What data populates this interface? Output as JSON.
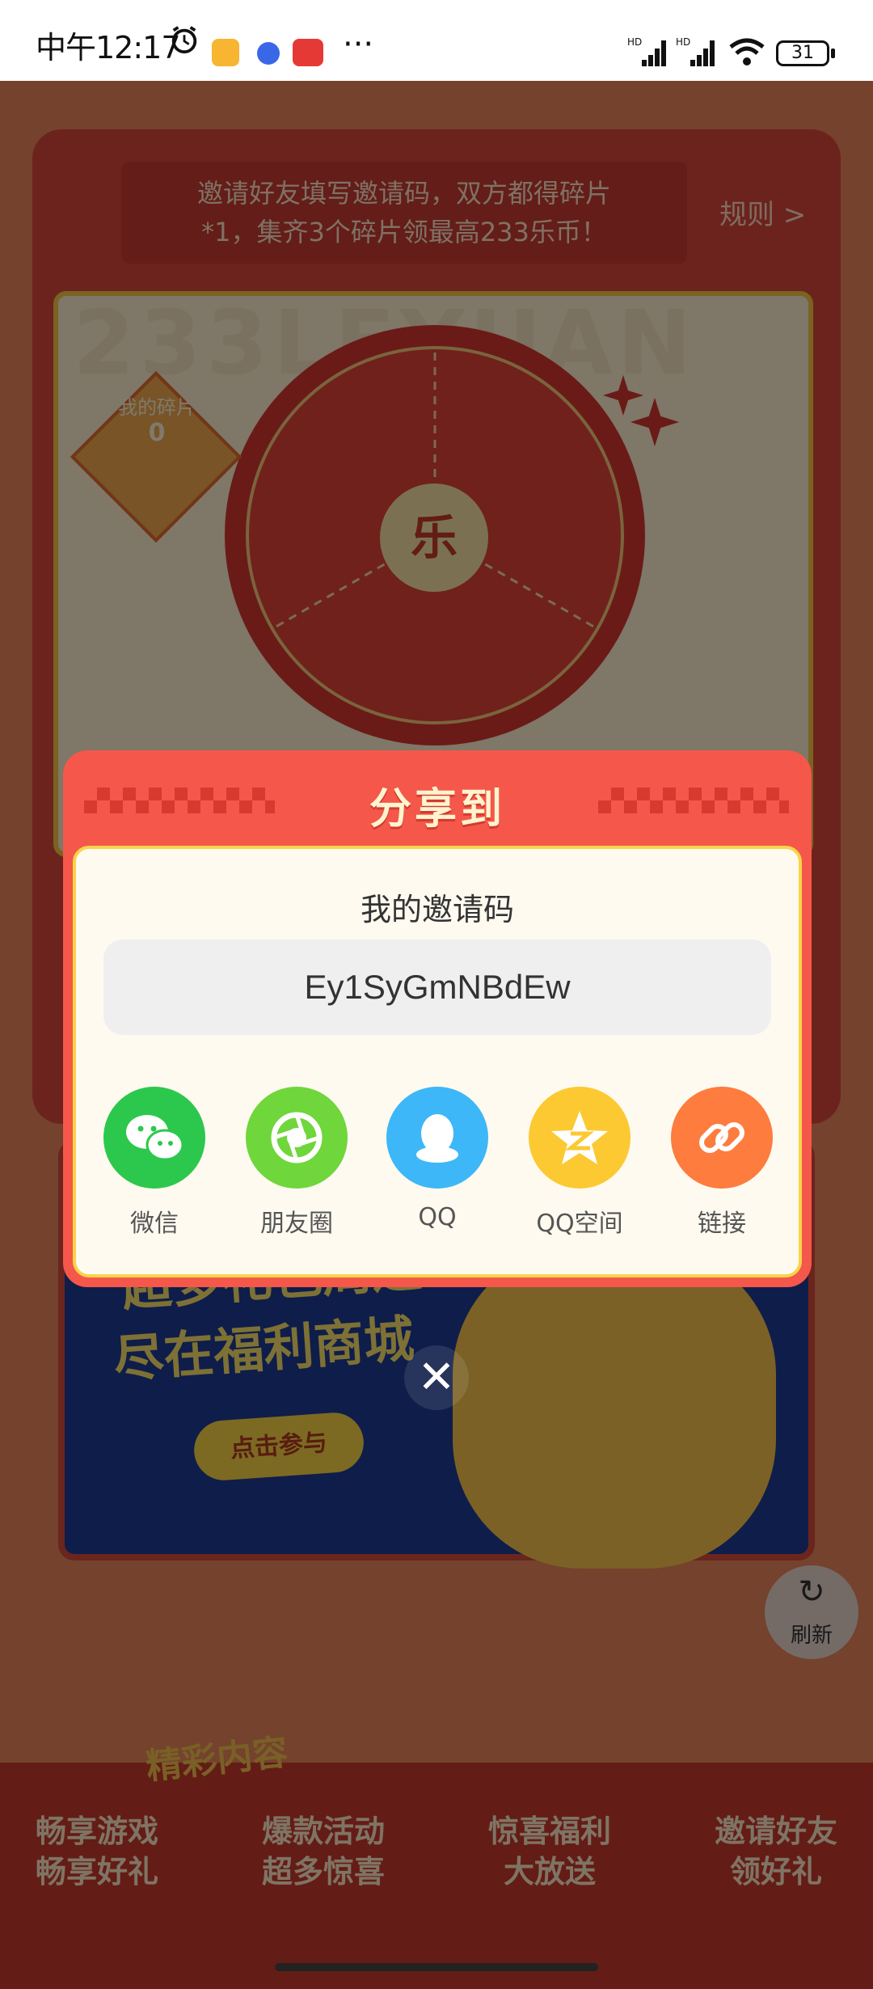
{
  "status_bar": {
    "time": "中午12:17",
    "battery": "31",
    "network": "HD"
  },
  "invite_banner": {
    "text_line1": "邀请好友填写邀请码，双方都得碎片",
    "text_line2": "*1，集齐3个碎片领最高233乐币！",
    "rules_link": "规则 >"
  },
  "wheel": {
    "bg_text": "233LEYUAN",
    "hub_label": "乐",
    "fragments_label": "我的碎片",
    "fragments_value": "0"
  },
  "mall_banner": {
    "title_line1": "超多礼包周边",
    "title_line2": "尽在福利商城",
    "button_label": "点击参与"
  },
  "refresh": {
    "label": "刷新"
  },
  "bottom_section": {
    "tag": "精彩内容",
    "features": [
      {
        "line1": "畅享游戏",
        "line2": "畅享好礼"
      },
      {
        "line1": "爆款活动",
        "line2": "超多惊喜"
      },
      {
        "line1": "惊喜福利",
        "line2": "大放送"
      },
      {
        "line1": "邀请好友",
        "line2": "领好礼"
      }
    ]
  },
  "share_modal": {
    "title": "分享到",
    "code_label": "我的邀请码",
    "invite_code": "Ey1SyGmNBdEw",
    "options": [
      {
        "label": "微信",
        "icon": "wechat-icon",
        "color": "#2cc84d"
      },
      {
        "label": "朋友圈",
        "icon": "moments-icon",
        "color": "#6fd63b"
      },
      {
        "label": "QQ",
        "icon": "qq-icon",
        "color": "#3db7f7"
      },
      {
        "label": "QQ空间",
        "icon": "qzone-icon",
        "color": "#fcc932"
      },
      {
        "label": "链接",
        "icon": "link-icon",
        "color": "#fd7c3e"
      }
    ],
    "close_label": "✕"
  }
}
